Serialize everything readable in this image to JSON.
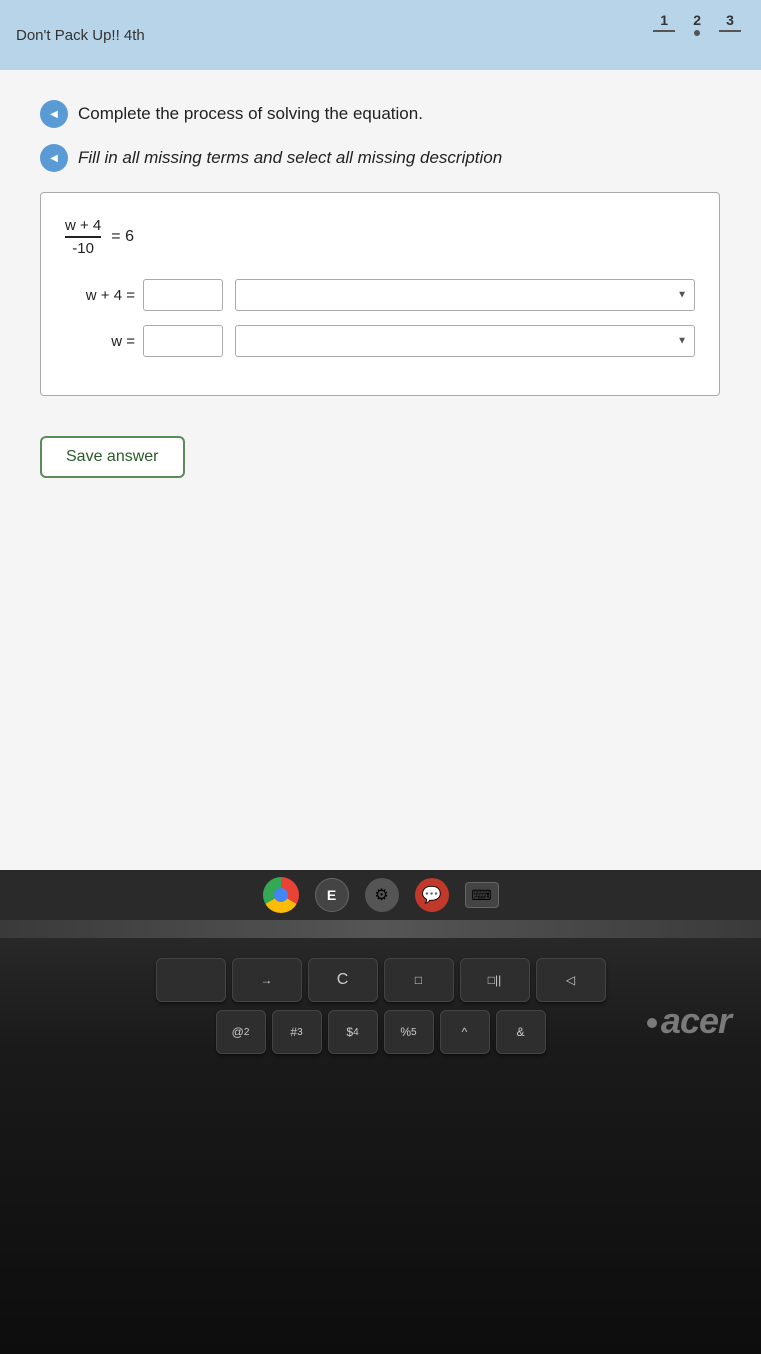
{
  "page": {
    "title": "Don't Pack Up!! 4th"
  },
  "progress": {
    "items": [
      {
        "number": "1",
        "type": "underline"
      },
      {
        "number": "2",
        "type": "dot"
      },
      {
        "number": "3",
        "type": "underline"
      }
    ]
  },
  "instructions": {
    "line1": "Complete the process of solving the equation.",
    "line2": "Fill in all missing terms and select all missing description"
  },
  "equation": {
    "initial": {
      "numerator": "w + 4",
      "denominator": "-10",
      "equals": "= 6"
    },
    "step1": {
      "label": "w + 4 =",
      "input_placeholder": "",
      "dropdown_placeholder": ""
    },
    "step2": {
      "label": "w =",
      "input_placeholder": "",
      "dropdown_placeholder": ""
    }
  },
  "buttons": {
    "save_answer": "Save answer"
  },
  "taskbar": {
    "icons": [
      "chrome",
      "E",
      "gear",
      "chat",
      "keyboard"
    ]
  },
  "keyboard": {
    "rows": [
      [
        "→",
        "C",
        "□",
        "□||",
        "◁"
      ],
      [
        "@",
        "#",
        "$",
        "%",
        "^",
        "&"
      ]
    ]
  },
  "branding": {
    "text": "acer"
  }
}
